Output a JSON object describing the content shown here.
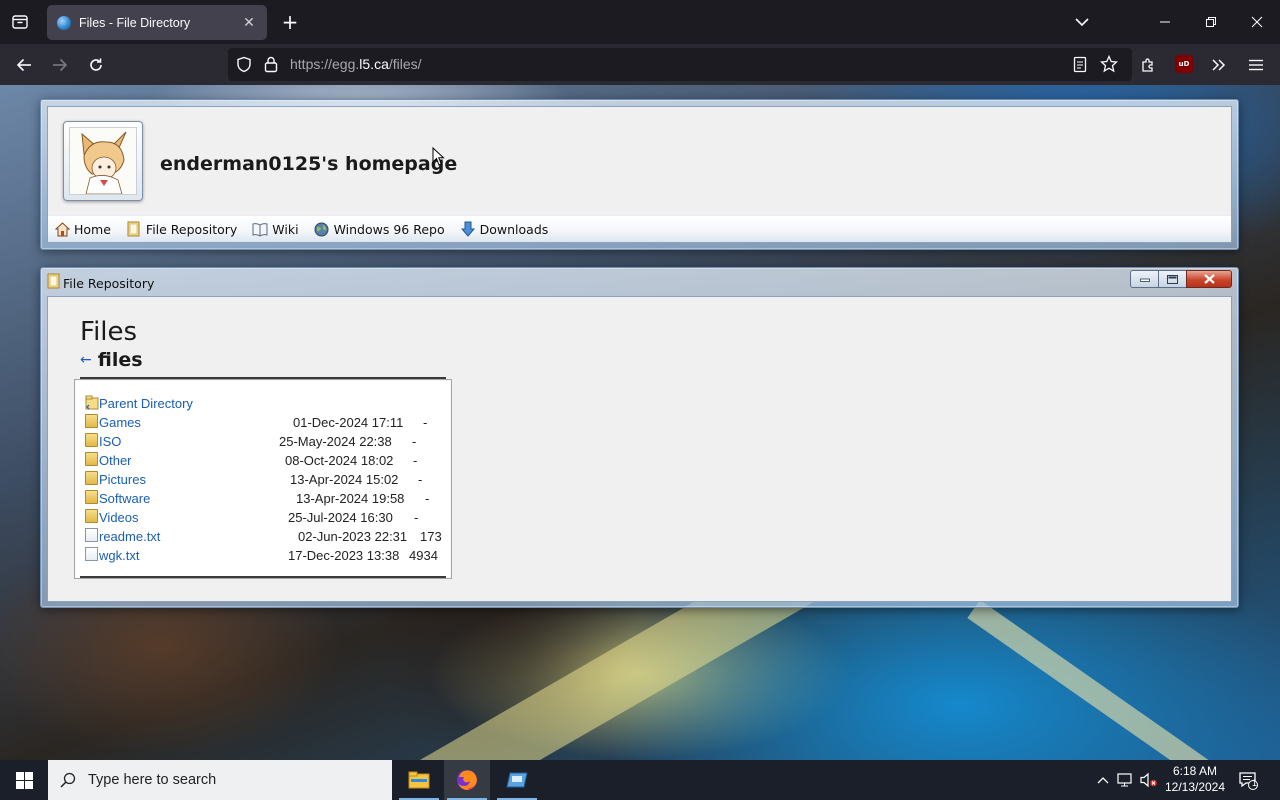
{
  "browser": {
    "tab_title": "Files - File Directory",
    "url_prefix": "https://egg.",
    "url_host": "l5.ca",
    "url_path": "/files/"
  },
  "site": {
    "title": "enderman0125's homepage",
    "nav": [
      {
        "label": "Home",
        "icon": "house-icon"
      },
      {
        "label": "File Repository",
        "icon": "folder-icon"
      },
      {
        "label": "Wiki",
        "icon": "book-icon"
      },
      {
        "label": "Windows 96 Repo",
        "icon": "globe-icon"
      },
      {
        "label": "Downloads",
        "icon": "download-arrow-icon"
      }
    ]
  },
  "repo_window": {
    "title": "File Repository",
    "heading": "Files",
    "subheading_arrow": "←",
    "subheading": "files",
    "entries": [
      {
        "name": "Parent Directory",
        "date": "",
        "size": "",
        "type": "parent"
      },
      {
        "name": "Games",
        "date": "01-Dec-2024 17:11",
        "size": "-",
        "type": "folder"
      },
      {
        "name": "ISO",
        "date": "25-May-2024 22:38",
        "size": "-",
        "type": "folder"
      },
      {
        "name": "Other",
        "date": "08-Oct-2024 18:02",
        "size": "-",
        "type": "folder"
      },
      {
        "name": "Pictures",
        "date": "13-Apr-2024 15:02",
        "size": "-",
        "type": "folder"
      },
      {
        "name": "Software",
        "date": "13-Apr-2024 19:58",
        "size": "-",
        "type": "folder"
      },
      {
        "name": "Videos",
        "date": "25-Jul-2024 16:30",
        "size": "-",
        "type": "folder"
      },
      {
        "name": "readme.txt",
        "date": "02-Jun-2023 22:31",
        "size": "173",
        "type": "file"
      },
      {
        "name": "wgk.txt",
        "date": "17-Dec-2023 13:38",
        "size": "4934",
        "type": "file"
      }
    ]
  },
  "taskbar": {
    "search_placeholder": "Type here to search",
    "time": "6:18 AM",
    "date": "12/13/2024",
    "notification_count": "1"
  },
  "colors": {
    "link": "#1a5fb4",
    "browser_bg": "#1c1b22",
    "toolbar_bg": "#2b2a33",
    "taskbar_bg": "#1b1f2a"
  }
}
